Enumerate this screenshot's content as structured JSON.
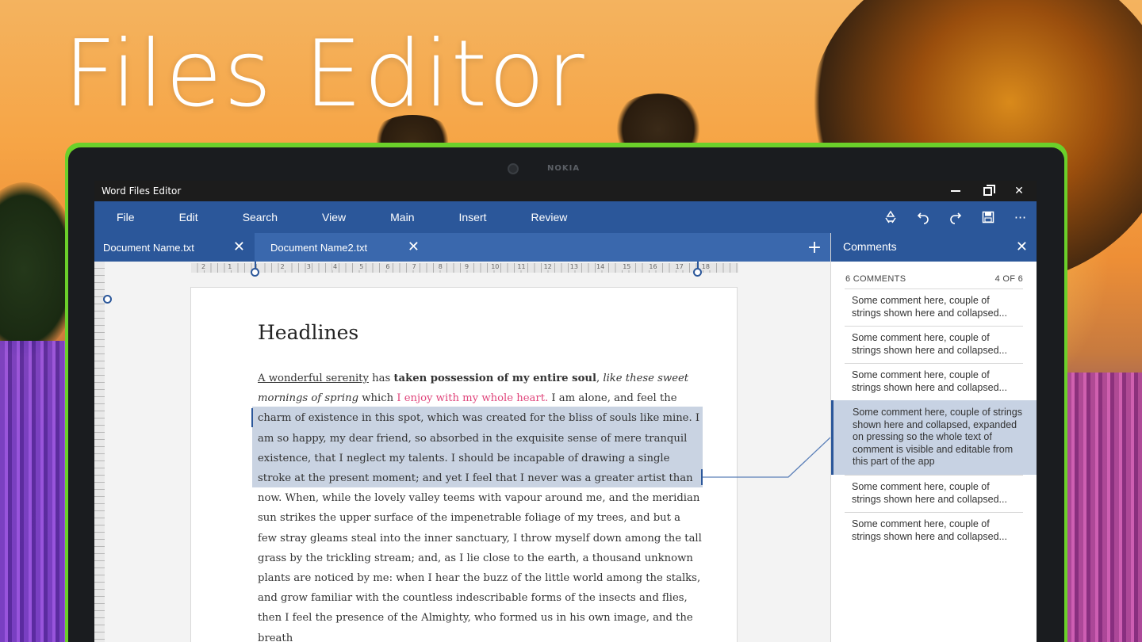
{
  "hero": {
    "title": "Files Editor"
  },
  "device": {
    "brand": "NOKIA"
  },
  "window": {
    "title": "Word Files Editor"
  },
  "menu": [
    "File",
    "Edit",
    "Search",
    "View",
    "Main",
    "Insert",
    "Review"
  ],
  "toolbar": {
    "icons": [
      "recycle-icon",
      "undo-icon",
      "redo-icon",
      "save-icon",
      "more-icon"
    ]
  },
  "tabs": [
    {
      "label": "Document Name.txt",
      "active": true
    },
    {
      "label": "Document Name2.txt",
      "active": false
    }
  ],
  "comments": {
    "title": "Comments",
    "count_label": "6 COMMENTS",
    "position_label": "4 OF 6",
    "items": [
      {
        "text": "Some comment here, couple of strings shown here and collapsed..."
      },
      {
        "text": "Some comment here, couple of strings shown here and collapsed..."
      },
      {
        "text": "Some comment here, couple of strings shown here and collapsed..."
      },
      {
        "text": "Some comment here, couple of strings shown here and collapsed, expanded on pressing so the whole text of comment is visible and editable from this part of the app",
        "expanded": true
      },
      {
        "text": "Some comment here, couple of strings shown here and collapsed..."
      },
      {
        "text": "Some comment here, couple of strings shown here and collapsed..."
      }
    ]
  },
  "document": {
    "heading": "Headlines",
    "runs": {
      "r1": "A wonderful serenity",
      "r2": " has ",
      "r3": "taken possession of my entire soul",
      "r4": ", ",
      "r5": "like these sweet mornings of spring",
      "r6": " which ",
      "r7": "I enjoy with my whole heart.",
      "r8": " I am alone, and feel the charm of existence ",
      "r9": "in this spot, which was created for the bliss of souls like mine. I am so happy, my dear friend, so absorbed in the exquisite sense of mere tranquil existence, that I neglect my talents. I should be incapable of drawing a single stroke at the present moment; and yet I feel that I never was a greater artist than now. When, while the lovely valley teems with",
      "r10": " vapour around me, and the meridian sun strikes the upper surface of the impenetrable foliage of my trees, and but a few stray gleams steal into the inner sanctuary, I throw myself down among the tall grass by the trickling stream; and, as I lie close to the earth, a thousand unknown plants are noticed by me: when I hear the buzz of the little world among the stalks, and grow familiar with the countless indescribable forms of the insects and flies, then I feel the presence of the Almighty, who formed us in his own image, and the breath"
    }
  },
  "ruler": {
    "ticks": [
      "2",
      "1",
      "1",
      "2",
      "3",
      "4",
      "5",
      "6",
      "7",
      "8",
      "9",
      "10",
      "11",
      "12",
      "13",
      "14",
      "15",
      "16",
      "17",
      "18"
    ]
  }
}
